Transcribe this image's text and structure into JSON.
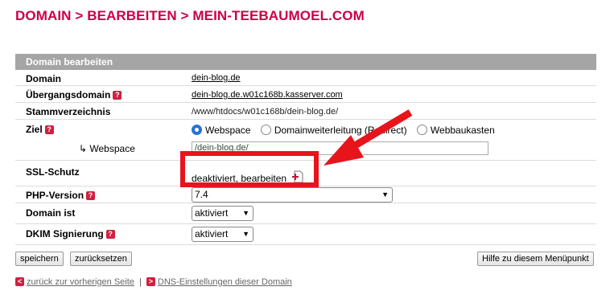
{
  "page": {
    "title": "DOMAIN > BEARBEITEN > MEIN-TEEBAUMOEL.COM"
  },
  "panel": {
    "header": "Domain bearbeiten",
    "domain": {
      "label": "Domain",
      "value": "dein-blog.de"
    },
    "transfer_domain": {
      "label": "Übergangsdomain",
      "value": "dein-blog.de.w01c168b.kasserver.com"
    },
    "root_dir": {
      "label": "Stammverzeichnis",
      "value": "/www/htdocs/w01c168b/dein-blog.de/"
    },
    "target": {
      "label": "Ziel",
      "options": [
        "Webspace",
        "Domainweiterleitung (Redirect)",
        "Webbaukasten"
      ],
      "selected": "Webspace"
    },
    "webspace": {
      "label": "↳ Webspace",
      "value": "/dein-blog.de/"
    },
    "ssl": {
      "label": "SSL-Schutz",
      "value": "deaktiviert, bearbeiten"
    },
    "php": {
      "label": "PHP-Version",
      "value": "7.4"
    },
    "domain_status": {
      "label": "Domain ist",
      "value": "aktiviert"
    },
    "dkim": {
      "label": "DKIM Signierung",
      "value": "aktiviert"
    }
  },
  "buttons": {
    "save": "speichern",
    "reset": "zurücksetzen",
    "help": "Hilfe zu diesem Menüpunkt"
  },
  "footer": {
    "back": "zurück zur vorherigen Seite",
    "separator": "|",
    "dns": "DNS-Einstellungen dieser Domain"
  },
  "colors": {
    "accent": "#cc0044",
    "header_bg": "#a5a5a5",
    "annotation": "#e8141c",
    "radio_selected": "#2a6fd6"
  },
  "icons": {
    "help": "help-question-icon",
    "ssl_edit": "red-plus-document-icon",
    "footer": "red-bullet-icon"
  }
}
